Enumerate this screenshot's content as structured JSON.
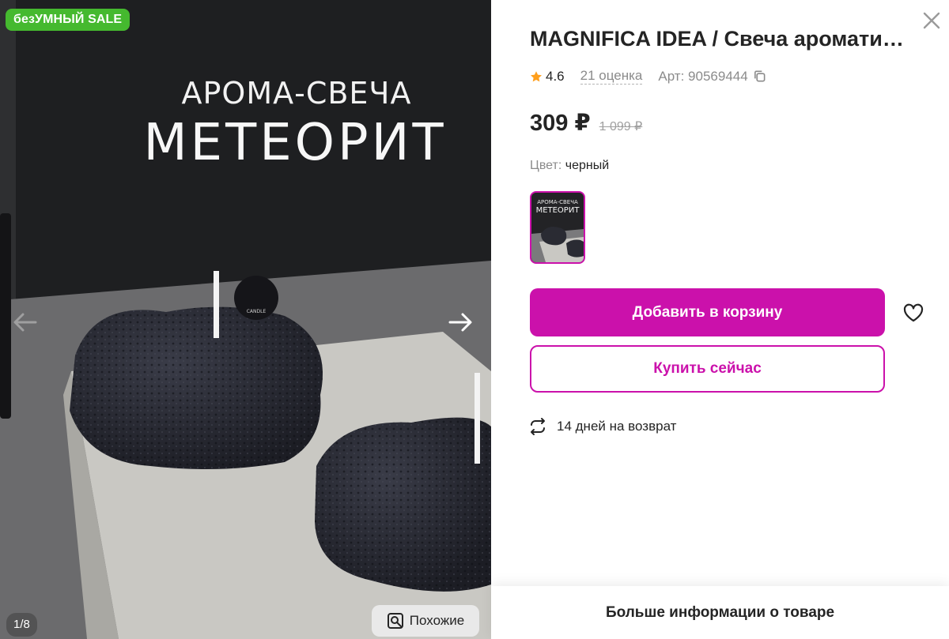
{
  "gallery": {
    "sale_badge": "безУМНЫЙ SALE",
    "image_title_line1": "АРОМА-СВЕЧА",
    "image_title_line2": "МЕТЕОРИТ",
    "counter": "1/8",
    "similar_label": "Похожие"
  },
  "product": {
    "title": "MAGNIFICA IDEA / Свеча ароматическая",
    "rating": "4.6",
    "reviews": "21 оценка",
    "article": "Арт: 90569444",
    "price": "309 ₽",
    "old_price": "1 099 ₽",
    "color_label": "Цвет:",
    "color_value": "черный",
    "swatch_title_line1": "АРОМА-СВЕЧА",
    "swatch_title_line2": "МЕТЕОРИТ"
  },
  "actions": {
    "add_to_cart": "Добавить в корзину",
    "buy_now": "Купить сейчас",
    "return_info": "14 дней на возврат",
    "more_info": "Больше информации о товаре"
  },
  "colors": {
    "accent": "#cb11ab",
    "sale_green": "#45b92f",
    "star": "#ff9f1c"
  },
  "icons": {
    "close": "close-icon",
    "star": "star-icon",
    "copy": "copy-icon",
    "heart": "heart-icon",
    "return": "return-arrows-icon",
    "search": "search-image-icon",
    "arrow_left": "arrow-left-icon",
    "arrow_right": "arrow-right-icon"
  }
}
